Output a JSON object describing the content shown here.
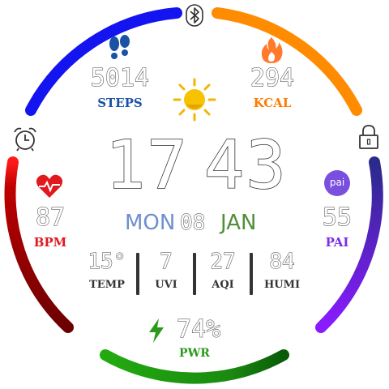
{
  "time": {
    "hours": "17",
    "minutes": "43"
  },
  "date": {
    "weekday": "MON",
    "day": "08",
    "month": "JAN"
  },
  "steps": {
    "value": "5014",
    "label": "STEPS"
  },
  "kcal": {
    "value": "294",
    "label": "KCAL"
  },
  "heart": {
    "value": "87",
    "label": "BPM"
  },
  "pai": {
    "value": "55",
    "label": "PAI",
    "badge": "pai"
  },
  "power": {
    "value": "74%",
    "label": "PWR",
    "level": 0.74
  },
  "stats": [
    {
      "value": "15°",
      "label": "TEMP"
    },
    {
      "value": "7",
      "label": "UVI"
    },
    {
      "value": "27",
      "label": "AQI"
    },
    {
      "value": "84",
      "label": "HUMI"
    }
  ],
  "icons": {
    "top": "bluetooth-icon",
    "left": "alarm-clock-icon",
    "right": "lock-icon",
    "steps": "footprints-icon",
    "kcal": "flame-icon",
    "weather": "sun-icon",
    "heart": "heart-pulse-icon",
    "power": "lightning-icon"
  },
  "colors": {
    "steps": "#1a52a6",
    "kcal": "#ff7a00",
    "heart": "#e0191f",
    "pai": "#7a2ee6",
    "power": "#2b9a1b",
    "date": "#6f8fd0",
    "month": "#4f8f38",
    "blue_arc": "#1414f0",
    "orange_arc": "#ff8c00",
    "red_arc": "#8b0000",
    "purple_arc": "#7a1fe0",
    "green_arc": "#1a9a10"
  }
}
